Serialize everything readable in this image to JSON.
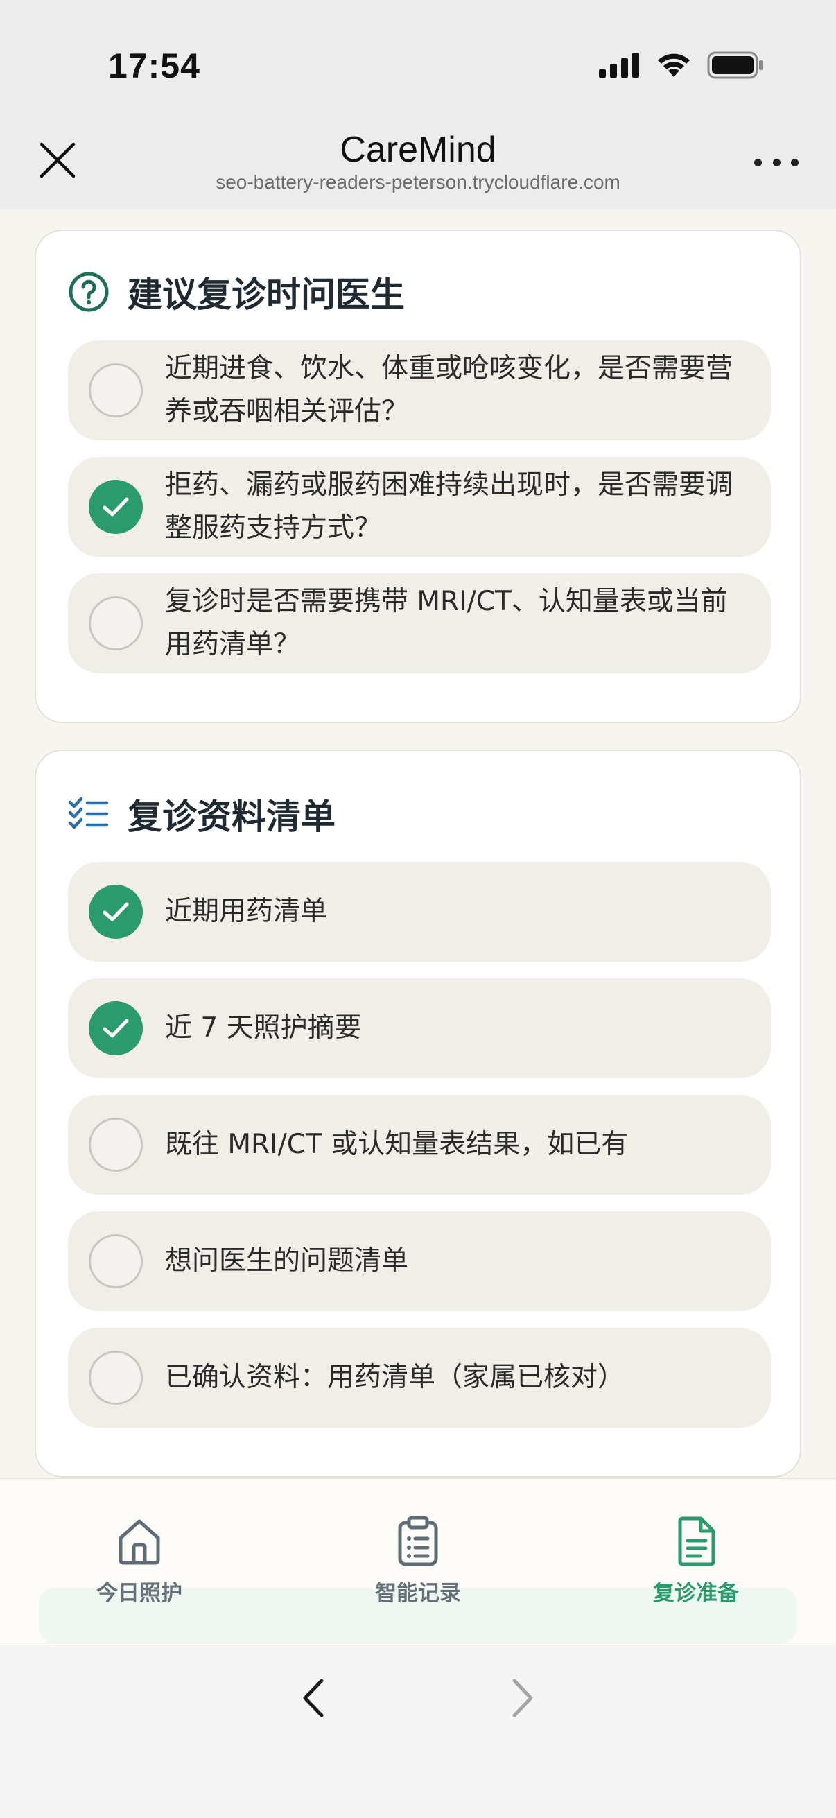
{
  "status_bar": {
    "time": "17:54"
  },
  "browser": {
    "title": "CareMind",
    "url": "seo-battery-readers-peterson.trycloudflare.com"
  },
  "sections": [
    {
      "icon": "question-circle-icon",
      "title": "建议复诊时问医生",
      "items": [
        {
          "text": "近期进食、饮水、体重或呛咳变化，是否需要营养或吞咽相关评估？",
          "checked": false
        },
        {
          "text": "拒药、漏药或服药困难持续出现时，是否需要调整服药支持方式？",
          "checked": true
        },
        {
          "text": "复诊时是否需要携带 MRI/CT、认知量表或当前用药清单？",
          "checked": false
        }
      ]
    },
    {
      "icon": "checklist-icon",
      "title": "复诊资料清单",
      "items": [
        {
          "text": "近期用药清单",
          "checked": true
        },
        {
          "text": "近 7 天照护摘要",
          "checked": true
        },
        {
          "text": "既往 MRI/CT 或认知量表结果，如已有",
          "checked": false
        },
        {
          "text": "想问医生的问题清单",
          "checked": false
        },
        {
          "text": "已确认资料：用药清单（家属已核对）",
          "checked": false
        }
      ]
    }
  ],
  "tabbar": {
    "tabs": [
      {
        "label": "今日照护",
        "icon": "home-icon",
        "active": false
      },
      {
        "label": "智能记录",
        "icon": "clipboard-icon",
        "active": false
      },
      {
        "label": "复诊准备",
        "icon": "document-icon",
        "active": true
      }
    ]
  },
  "colors": {
    "accent": "#2b9a6c",
    "item_bg": "#f1eee8",
    "page_bg": "#f7f5ef"
  }
}
